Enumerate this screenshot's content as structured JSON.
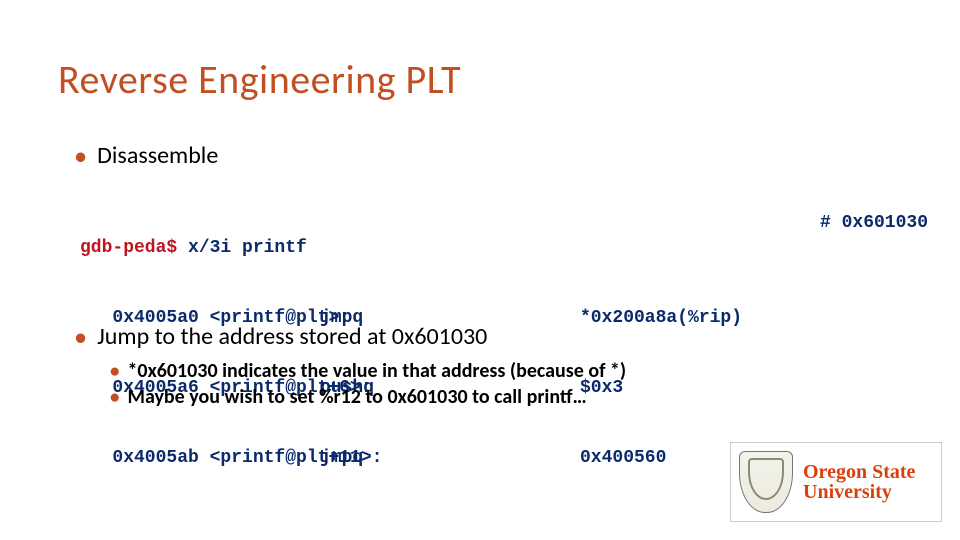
{
  "title": "Reverse Engineering PLT",
  "bullets": {
    "disassemble": "Disassemble",
    "jump": "Jump to the address stored at 0x601030",
    "sub1": "*0x601030 indicates the value in that address (because of *)",
    "sub2": "Maybe you wish to set %r12 to 0x601030 to call printf…"
  },
  "code": {
    "prompt": "gdb-peda$",
    "cmd": " x/3i printf",
    "rows": [
      {
        "left": "   0x4005a0 <printf@plt>:",
        "op": "jmpq",
        "arg": "*0x200a8a(%rip)"
      },
      {
        "left": "   0x4005a6 <printf@plt+6>:",
        "op": "pushq",
        "arg": "$0x3"
      },
      {
        "left": "   0x4005ab <printf@plt+11>:",
        "op": "jmpq",
        "arg": "0x400560"
      }
    ],
    "comment": "# 0x601030"
  },
  "logo": {
    "line1": "Oregon State",
    "line2": "University"
  }
}
